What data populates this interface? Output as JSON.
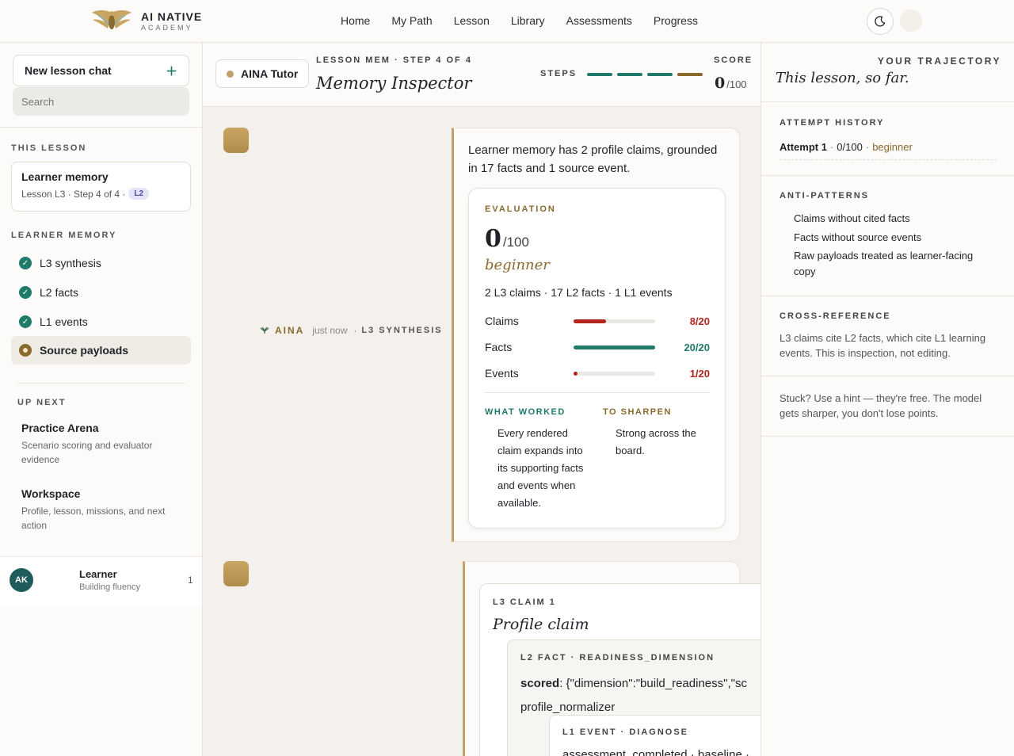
{
  "brand": {
    "name": "AI NATIVE",
    "sub": "ACADEMY"
  },
  "nav": [
    "Home",
    "My Path",
    "Lesson",
    "Library",
    "Assessments",
    "Progress"
  ],
  "icons": {
    "theme": "moon-icon",
    "plus": "plus-icon",
    "check": "check-icon",
    "leaf": "leaf-icon"
  },
  "colors": {
    "accent": "#1f7a6a",
    "gold": "#8a6a2e",
    "danger": "#b3261e"
  },
  "sidebar": {
    "new_chat": "New lesson chat",
    "search_placeholder": "Search",
    "this_lesson_label": "THIS LESSON",
    "lesson": {
      "title": "Learner memory",
      "meta": "Lesson L3 · Step 4 of 4 ·",
      "badge": "L2"
    },
    "memory_label": "LEARNER MEMORY",
    "memory_items": [
      {
        "label": "L3 synthesis",
        "done": true
      },
      {
        "label": "L2 facts",
        "done": true
      },
      {
        "label": "L1 events",
        "done": true
      },
      {
        "label": "Source payloads",
        "done": false,
        "active": true
      }
    ],
    "up_next_label": "UP NEXT",
    "up_next": [
      {
        "title": "Practice Arena",
        "sub": "Scenario scoring and evaluator evidence"
      },
      {
        "title": "Workspace",
        "sub": "Profile, lesson, missions, and next action"
      }
    ],
    "learner": {
      "initials": "AK",
      "name": "Learner",
      "role": "Building fluency",
      "count": "1"
    }
  },
  "lesson_header": {
    "tutor": "AINA Tutor",
    "crumb": "LESSON MEM · STEP 4 OF 4",
    "title": "Memory Inspector",
    "steps_label": "STEPS",
    "steps_total": 4,
    "steps_current": 4,
    "score_label": "SCORE",
    "score": "0",
    "score_max": "/100"
  },
  "message": {
    "author": "AINA",
    "time": "just now",
    "kind": "L3 SYNTHESIS",
    "lead": "Learner memory has 2 profile claims, grounded in 17 facts and 1 source event.",
    "evaluation": {
      "label": "EVALUATION",
      "score": "0",
      "max": "/100",
      "level": "beginner",
      "summary": "2 L3 claims · 17 L2 facts · 1 L1 events",
      "bars": [
        {
          "name": "Claims",
          "value": "8/20",
          "fraction": 0.4,
          "color": "#b3261e"
        },
        {
          "name": "Facts",
          "value": "20/20",
          "fraction": 1.0,
          "color": "#1f7a6a"
        },
        {
          "name": "Events",
          "value": "1/20",
          "fraction": 0.05,
          "color": "#b3261e"
        }
      ],
      "worked_label": "WHAT WORKED",
      "worked": "Every rendered claim expands into its supporting facts and events when available.",
      "sharpen_label": "TO SHARPEN",
      "sharpen": "Strong across the board."
    }
  },
  "claim": {
    "label": "L3 CLAIM 1",
    "title": "Profile claim",
    "fact_label": "L2 FACT · READINESS_DIMENSION",
    "fact_key": "scored",
    "fact_value": ": {\"dimension\":\"build_readiness\",\"sc",
    "fact_source": "profile_normalizer",
    "event_label": "L1 EVENT · DIAGNOSE",
    "event_body": "assessment_completed · baseline · "
  },
  "right": {
    "kicker": "YOUR TRAJECTORY",
    "title": "This lesson, so far.",
    "history_label": "ATTEMPT HISTORY",
    "attempt": {
      "name": "Attempt 1",
      "score": "0/100",
      "level": "beginner"
    },
    "anti_label": "ANTI-PATTERNS",
    "anti": [
      "Claims without cited facts",
      "Facts without source events",
      "Raw payloads treated as learner-facing copy"
    ],
    "xref_label": "CROSS-REFERENCE",
    "xref": "L3 claims cite L2 facts, which cite L1 learning events. This is inspection, not editing.",
    "hint": "Stuck? Use a hint — they're free. The model gets sharper, you don't lose points."
  }
}
